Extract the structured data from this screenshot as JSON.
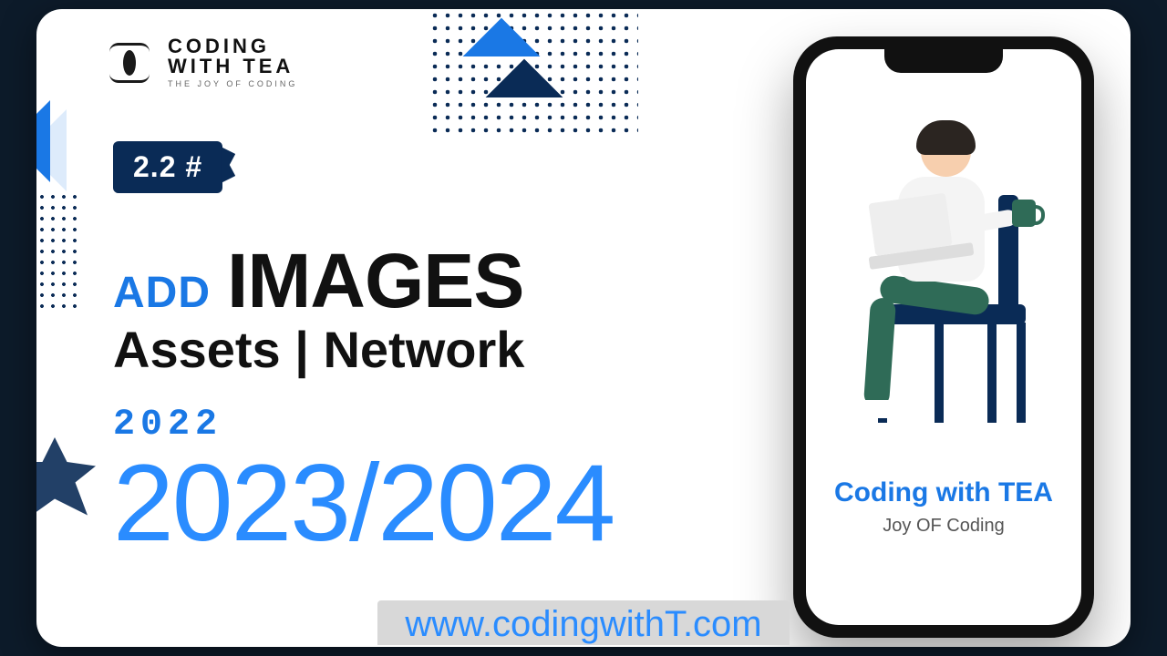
{
  "brand": {
    "line1": "CODING",
    "line2": "WITH TEA",
    "tagline": "THE JOY OF CODING"
  },
  "chip": {
    "label": "2.2 #"
  },
  "headline": {
    "word_accent": "ADD",
    "word_main": "IMAGES",
    "line2": "Assets | Network",
    "year_small": "2022",
    "year_big": "2023/2024"
  },
  "phone": {
    "title": "Coding with TEA",
    "subtitle": "Joy OF Coding"
  },
  "footer": {
    "url": "www.codingwithT.com"
  },
  "colors": {
    "accent_blue": "#1a78e5",
    "navy": "#0a2b56",
    "bright_blue": "#2a8cff"
  }
}
